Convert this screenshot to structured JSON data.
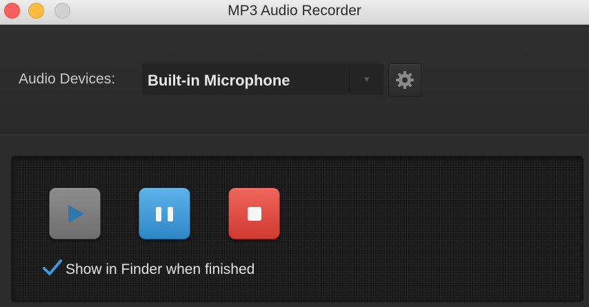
{
  "window": {
    "title": "MP3 Audio Recorder"
  },
  "devices": {
    "label": "Audio Devices:",
    "selected": "Built-in Microphone"
  },
  "controls": {
    "show_in_finder_label": "Show in Finder when finished",
    "show_in_finder_checked": true
  },
  "icons": {
    "close": "close-icon",
    "minimize": "minimize-icon",
    "zoom": "zoom-icon",
    "dropdown": "chevron-down-icon",
    "settings": "gear-icon",
    "play": "play-icon",
    "pause": "pause-icon",
    "stop": "stop-icon",
    "check": "checkmark-icon"
  },
  "colors": {
    "close": "#fc605c",
    "minimize": "#fdbc40",
    "zoom_disabled": "#d1d1d1",
    "pause_blue": "#3d96d6",
    "stop_red": "#df4a40",
    "play_gray": "#7d7d7d",
    "check_blue": "#3b9be0"
  }
}
